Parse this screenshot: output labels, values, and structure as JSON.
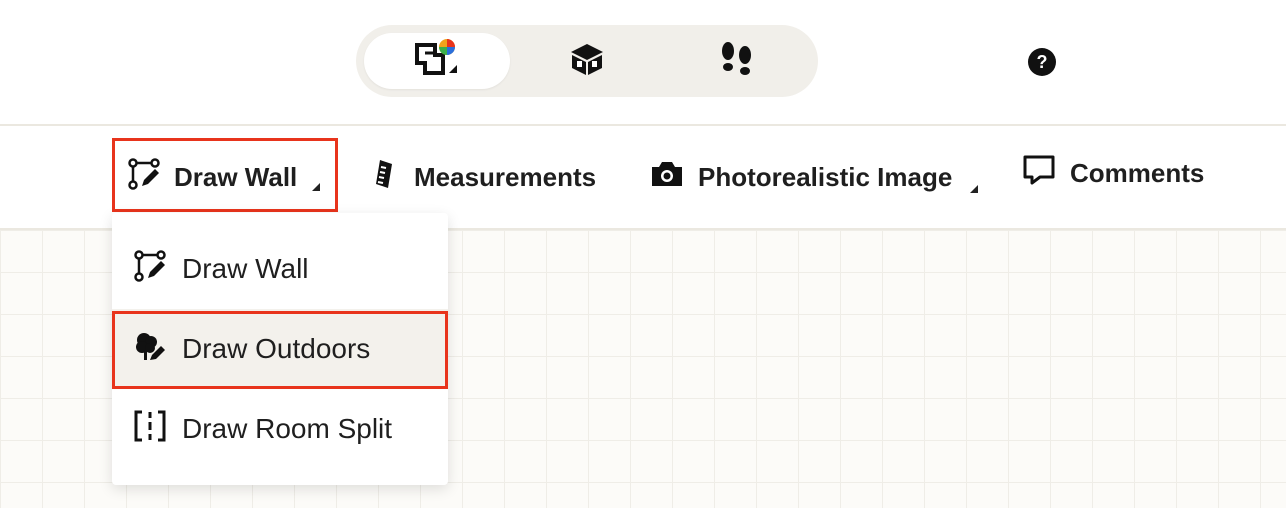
{
  "view_switch": {
    "items": [
      {
        "name": "2D floorplan",
        "icon": "floorplan-2d-icon",
        "active": true
      },
      {
        "name": "3D view",
        "icon": "cube-3d-icon",
        "active": false
      },
      {
        "name": "Walkthrough",
        "icon": "footsteps-icon",
        "active": false
      }
    ]
  },
  "help": {
    "label": "?"
  },
  "toolbar": {
    "draw_wall_label": "Draw Wall",
    "measurements_label": "Measurements",
    "photo_label": "Photorealistic Image",
    "comments_label": "Comments"
  },
  "dropdown": {
    "items": [
      {
        "label": "Draw Wall",
        "icon": "draw-wall-icon"
      },
      {
        "label": "Draw Outdoors",
        "icon": "tree-pencil-icon",
        "selected": true
      },
      {
        "label": "Draw Room Split",
        "icon": "room-split-icon"
      }
    ]
  },
  "colors": {
    "highlight": "#e8341c",
    "switch_bg": "#f1efea",
    "selected_bg": "#f3f1ec"
  }
}
